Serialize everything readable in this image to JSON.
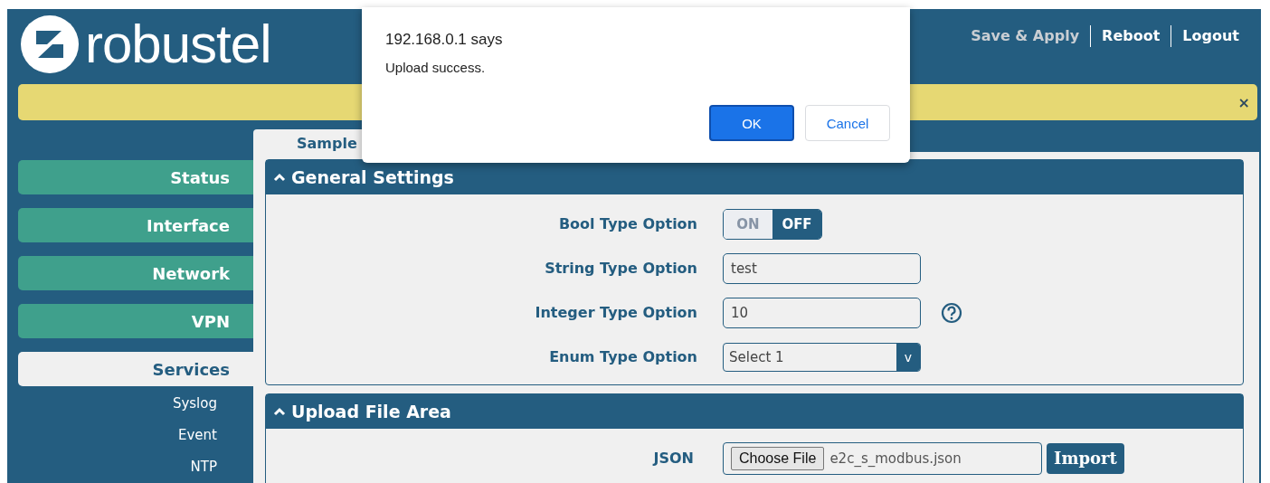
{
  "header": {
    "logo": "robustel",
    "links": [
      {
        "label": "Save & Apply",
        "disabled": true
      },
      {
        "label": "Reboot",
        "disabled": false
      },
      {
        "label": "Logout",
        "disabled": false
      }
    ]
  },
  "notice_bar": {
    "close": "×"
  },
  "sidebar": {
    "items": [
      {
        "label": "Status",
        "selected": false
      },
      {
        "label": "Interface",
        "selected": false
      },
      {
        "label": "Network",
        "selected": false
      },
      {
        "label": "VPN",
        "selected": false
      },
      {
        "label": "Services",
        "selected": true,
        "children": [
          {
            "label": "Syslog"
          },
          {
            "label": "Event"
          },
          {
            "label": "NTP"
          }
        ]
      }
    ]
  },
  "tabs": [
    {
      "label": "Sample",
      "selected": true
    }
  ],
  "sections": [
    {
      "title": "General Settings",
      "expanded": true,
      "fields": [
        {
          "kind": "toggle",
          "label": "Bool Type Option",
          "on_label": "ON",
          "off_label": "OFF",
          "on": false
        },
        {
          "kind": "text",
          "label": "String Type Option",
          "value": "test",
          "help": false
        },
        {
          "kind": "text",
          "label": "Integer Type Option",
          "value": "10",
          "help": true
        },
        {
          "kind": "select",
          "label": "Enum Type Option",
          "value": "Select 1",
          "arrow": "v"
        }
      ]
    },
    {
      "title": "Upload File Area",
      "expanded": true,
      "fields": [
        {
          "kind": "file",
          "label": "JSON",
          "button": "Choose File",
          "file_name": "e2c_s_modbus.json",
          "action": "Import"
        }
      ]
    }
  ],
  "dialog": {
    "title": "192.168.0.1 says",
    "message": "Upload success.",
    "buttons": [
      {
        "label": "OK",
        "selected": true
      },
      {
        "label": "Cancel",
        "selected": false
      }
    ]
  }
}
